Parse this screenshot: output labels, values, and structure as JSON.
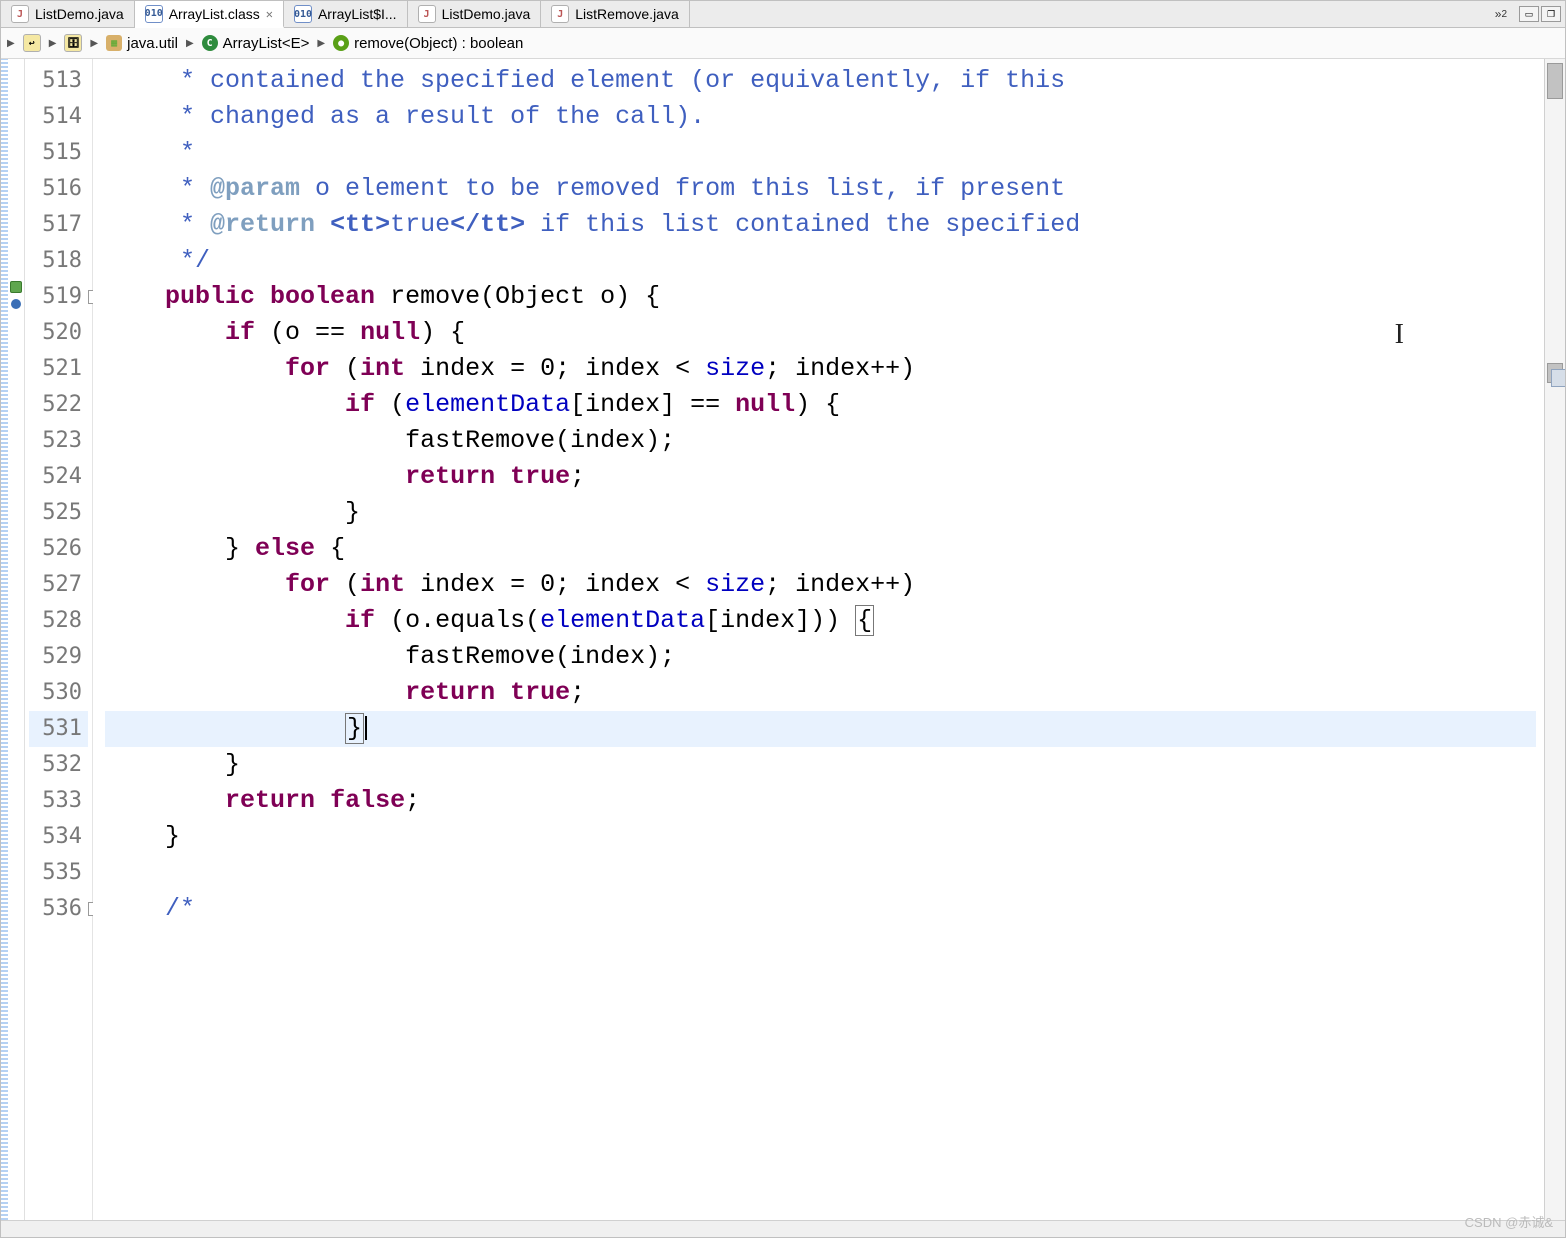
{
  "tabs": [
    {
      "label": "ListDemo.java",
      "icon": "java-file-icon",
      "active": false,
      "closable": false
    },
    {
      "label": "ArrayList.class",
      "icon": "class-file-icon",
      "active": true,
      "closable": true
    },
    {
      "label": "ArrayList$I...",
      "icon": "class-file-icon",
      "active": false,
      "closable": false
    },
    {
      "label": "ListDemo.java",
      "icon": "java-file-icon",
      "active": false,
      "closable": false
    },
    {
      "label": "ListRemove.java",
      "icon": "java-file-icon",
      "active": false,
      "closable": false
    }
  ],
  "tab_overflow": {
    "glyph": "»",
    "count": "2"
  },
  "breadcrumb": {
    "segments": [
      {
        "icon": "nav-back-icon",
        "label": ""
      },
      {
        "icon": "nav-jar-icon",
        "label": ""
      },
      {
        "icon": "package-icon",
        "label": "java.util"
      },
      {
        "icon": "class-icon",
        "label": "ArrayList<E>"
      },
      {
        "icon": "method-icon",
        "label": "remove(Object) : boolean"
      }
    ]
  },
  "line_numbers": [
    "513",
    "514",
    "515",
    "516",
    "517",
    "518",
    "519",
    "520",
    "521",
    "522",
    "523",
    "524",
    "525",
    "526",
    "527",
    "528",
    "529",
    "530",
    "531",
    "532",
    "533",
    "534",
    "535",
    "536"
  ],
  "fold_markers": {
    "519": "-",
    "536": "-"
  },
  "code": {
    "c513": " * contained the specified element (or equivalently, if this",
    "c514": " * changed as a result of the call).",
    "c515": " *",
    "c516_pre": " * ",
    "c516_ann": "@param",
    "c516_post": " o element to be removed from this list, if present",
    "c517_pre": " * ",
    "c517_ann": "@return",
    "c517_mid": " ",
    "c517_t1": "<tt>",
    "c517_v": "true",
    "c517_t2": "</tt>",
    "c517_post": " if this list contained the specified",
    "c518": " */",
    "c519_kw1": "public",
    "c519_kw2": "boolean",
    "c519_rest": " remove(Object o) {",
    "c520_kw": "if",
    "c520_mid": " (o == ",
    "c520_null": "null",
    "c520_end": ") {",
    "c521_kw": "for",
    "c521_a": " (",
    "c521_int": "int",
    "c521_b": " index = 0; index < ",
    "c521_fld": "size",
    "c521_c": "; index++)",
    "c522_kw": "if",
    "c522_a": " (",
    "c522_fld": "elementData",
    "c522_b": "[index] == ",
    "c522_null": "null",
    "c522_c": ") {",
    "c523": "fastRemove(index);",
    "c524_kw": "return",
    "c524_sp": " ",
    "c524_v": "true",
    "c524_e": ";",
    "c525": "}",
    "c526_a": "} ",
    "c526_kw": "else",
    "c526_b": " {",
    "c527_kw": "for",
    "c527_a": " (",
    "c527_int": "int",
    "c527_b": " index = 0; index < ",
    "c527_fld": "size",
    "c527_c": "; index++)",
    "c528_kw": "if",
    "c528_a": " (o.equals(",
    "c528_fld": "elementData",
    "c528_b": "[index])) ",
    "c528_br": "{",
    "c529": "fastRemove(index);",
    "c530_kw": "return",
    "c530_sp": " ",
    "c530_v": "true",
    "c530_e": ";",
    "c531": "}",
    "c532": "}",
    "c533_kw": "return",
    "c533_sp": " ",
    "c533_v": "false",
    "c533_e": ";",
    "c534": "}",
    "c535": "",
    "c536": "/*"
  },
  "watermark": "CSDN @赤诚&",
  "cursor_glyph": "I"
}
